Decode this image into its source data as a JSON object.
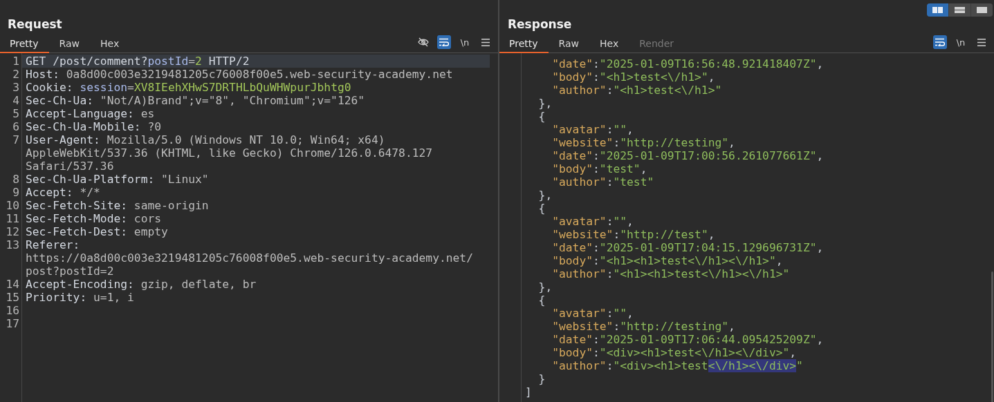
{
  "layout_buttons": [
    {
      "kind": "columns",
      "selected": true
    },
    {
      "kind": "rows",
      "selected": false
    },
    {
      "kind": "single",
      "selected": false
    }
  ],
  "request": {
    "title": "Request",
    "tabs": [
      {
        "label": "Pretty",
        "selected": true,
        "disabled": false
      },
      {
        "label": "Raw",
        "selected": false,
        "disabled": false
      },
      {
        "label": "Hex",
        "selected": false,
        "disabled": false
      }
    ],
    "toolbar": [
      {
        "kind": "hide",
        "on": false
      },
      {
        "kind": "wrap",
        "on": true
      },
      {
        "kind": "newline",
        "on": false,
        "label": "\\n"
      },
      {
        "kind": "menu",
        "on": false
      }
    ],
    "lines": [
      {
        "number": "1",
        "current": true,
        "rows": [
          [
            {
              "kind": "name",
              "text": "GET /post/comment?"
            },
            {
              "kind": "param",
              "text": "postId"
            },
            {
              "kind": "value",
              "text": "="
            },
            {
              "kind": "literal",
              "text": "2"
            },
            {
              "kind": "name",
              "text": " HTTP/2"
            }
          ]
        ]
      },
      {
        "number": "2",
        "current": false,
        "rows": [
          [
            {
              "kind": "name",
              "text": "Host:"
            },
            {
              "kind": "value",
              "text": " 0a8d00c003e3219481205c76008f00e5.web-security-academy.net"
            }
          ]
        ]
      },
      {
        "number": "3",
        "current": false,
        "rows": [
          [
            {
              "kind": "name",
              "text": "Cookie:"
            },
            {
              "kind": "value",
              "text": " "
            },
            {
              "kind": "param",
              "text": "session"
            },
            {
              "kind": "value",
              "text": "="
            },
            {
              "kind": "literal",
              "text": "XV8IEehXHwS7DRTHLbQuWHWpurJbhtg0"
            }
          ]
        ]
      },
      {
        "number": "4",
        "current": false,
        "rows": [
          [
            {
              "kind": "name",
              "text": "Sec-Ch-Ua:"
            },
            {
              "kind": "value",
              "text": " \"Not/A)Brand\";v=\"8\", \"Chromium\";v=\"126\""
            }
          ]
        ]
      },
      {
        "number": "5",
        "current": false,
        "rows": [
          [
            {
              "kind": "name",
              "text": "Accept-Language:"
            },
            {
              "kind": "value",
              "text": " es"
            }
          ]
        ]
      },
      {
        "number": "6",
        "current": false,
        "rows": [
          [
            {
              "kind": "name",
              "text": "Sec-Ch-Ua-Mobile:"
            },
            {
              "kind": "value",
              "text": " ?0"
            }
          ]
        ]
      },
      {
        "number": "7",
        "current": false,
        "rows": [
          [
            {
              "kind": "name",
              "text": "User-Agent:"
            },
            {
              "kind": "value",
              "text": " Mozilla/5.0 (Windows NT 10.0; Win64; x64)"
            }
          ],
          [
            {
              "kind": "value",
              "text": "AppleWebKit/537.36 (KHTML, like Gecko) Chrome/126.0.6478.127"
            }
          ],
          [
            {
              "kind": "value",
              "text": "Safari/537.36"
            }
          ]
        ]
      },
      {
        "number": "8",
        "current": false,
        "rows": [
          [
            {
              "kind": "name",
              "text": "Sec-Ch-Ua-Platform:"
            },
            {
              "kind": "value",
              "text": " \"Linux\""
            }
          ]
        ]
      },
      {
        "number": "9",
        "current": false,
        "rows": [
          [
            {
              "kind": "name",
              "text": "Accept:"
            },
            {
              "kind": "value",
              "text": " */*"
            }
          ]
        ]
      },
      {
        "number": "10",
        "current": false,
        "rows": [
          [
            {
              "kind": "name",
              "text": "Sec-Fetch-Site:"
            },
            {
              "kind": "value",
              "text": " same-origin"
            }
          ]
        ]
      },
      {
        "number": "11",
        "current": false,
        "rows": [
          [
            {
              "kind": "name",
              "text": "Sec-Fetch-Mode:"
            },
            {
              "kind": "value",
              "text": " cors"
            }
          ]
        ]
      },
      {
        "number": "12",
        "current": false,
        "rows": [
          [
            {
              "kind": "name",
              "text": "Sec-Fetch-Dest:"
            },
            {
              "kind": "value",
              "text": " empty"
            }
          ]
        ]
      },
      {
        "number": "13",
        "current": false,
        "rows": [
          [
            {
              "kind": "name",
              "text": "Referer:"
            }
          ],
          [
            {
              "kind": "value",
              "text": "https://0a8d00c003e3219481205c76008f00e5.web-security-academy.net/"
            }
          ],
          [
            {
              "kind": "value",
              "text": "post?postId=2"
            }
          ]
        ]
      },
      {
        "number": "14",
        "current": false,
        "rows": [
          [
            {
              "kind": "name",
              "text": "Accept-Encoding:"
            },
            {
              "kind": "value",
              "text": " gzip, deflate, br"
            }
          ]
        ]
      },
      {
        "number": "15",
        "current": false,
        "rows": [
          [
            {
              "kind": "name",
              "text": "Priority:"
            },
            {
              "kind": "value",
              "text": " u=1, i"
            }
          ]
        ]
      },
      {
        "number": "16",
        "current": false,
        "rows": [
          []
        ]
      },
      {
        "number": "17",
        "current": false,
        "rows": [
          []
        ]
      }
    ]
  },
  "response": {
    "title": "Response",
    "tabs": [
      {
        "label": "Pretty",
        "selected": true,
        "disabled": false
      },
      {
        "label": "Raw",
        "selected": false,
        "disabled": false
      },
      {
        "label": "Hex",
        "selected": false,
        "disabled": false
      },
      {
        "label": "Render",
        "selected": false,
        "disabled": true
      }
    ],
    "toolbar": [
      {
        "kind": "wrap",
        "on": true
      },
      {
        "kind": "newline",
        "on": false,
        "label": "\\n"
      },
      {
        "kind": "menu",
        "on": false
      }
    ],
    "lines": [
      {
        "kind": "field",
        "segments": [
          {
            "kind": "key",
            "text": "\"date\""
          },
          {
            "kind": "punct",
            "text": ":"
          },
          {
            "kind": "string",
            "text": "\"2025-01-09T16:56:48.921418407Z\""
          },
          {
            "kind": "punct",
            "text": ","
          }
        ]
      },
      {
        "kind": "field",
        "segments": [
          {
            "kind": "key",
            "text": "\"body\""
          },
          {
            "kind": "punct",
            "text": ":"
          },
          {
            "kind": "string",
            "text": "\"<h1>test<\\/h1>\""
          },
          {
            "kind": "punct",
            "text": ","
          }
        ]
      },
      {
        "kind": "field",
        "segments": [
          {
            "kind": "key",
            "text": "\"author\""
          },
          {
            "kind": "punct",
            "text": ":"
          },
          {
            "kind": "string",
            "text": "\"<h1>test<\\/h1>\""
          }
        ]
      },
      {
        "kind": "object",
        "segments": [
          {
            "kind": "punct",
            "text": "},"
          }
        ]
      },
      {
        "kind": "object",
        "segments": [
          {
            "kind": "punct",
            "text": "{"
          }
        ]
      },
      {
        "kind": "field",
        "segments": [
          {
            "kind": "key",
            "text": "\"avatar\""
          },
          {
            "kind": "punct",
            "text": ":"
          },
          {
            "kind": "string",
            "text": "\"\""
          },
          {
            "kind": "punct",
            "text": ","
          }
        ]
      },
      {
        "kind": "field",
        "segments": [
          {
            "kind": "key",
            "text": "\"website\""
          },
          {
            "kind": "punct",
            "text": ":"
          },
          {
            "kind": "string",
            "text": "\"http://testing\""
          },
          {
            "kind": "punct",
            "text": ","
          }
        ]
      },
      {
        "kind": "field",
        "segments": [
          {
            "kind": "key",
            "text": "\"date\""
          },
          {
            "kind": "punct",
            "text": ":"
          },
          {
            "kind": "string",
            "text": "\"2025-01-09T17:00:56.261077661Z\""
          },
          {
            "kind": "punct",
            "text": ","
          }
        ]
      },
      {
        "kind": "field",
        "segments": [
          {
            "kind": "key",
            "text": "\"body\""
          },
          {
            "kind": "punct",
            "text": ":"
          },
          {
            "kind": "string",
            "text": "\"test\""
          },
          {
            "kind": "punct",
            "text": ","
          }
        ]
      },
      {
        "kind": "field",
        "segments": [
          {
            "kind": "key",
            "text": "\"author\""
          },
          {
            "kind": "punct",
            "text": ":"
          },
          {
            "kind": "string",
            "text": "\"test\""
          }
        ]
      },
      {
        "kind": "object",
        "segments": [
          {
            "kind": "punct",
            "text": "},"
          }
        ]
      },
      {
        "kind": "object",
        "segments": [
          {
            "kind": "punct",
            "text": "{"
          }
        ]
      },
      {
        "kind": "field",
        "segments": [
          {
            "kind": "key",
            "text": "\"avatar\""
          },
          {
            "kind": "punct",
            "text": ":"
          },
          {
            "kind": "string",
            "text": "\"\""
          },
          {
            "kind": "punct",
            "text": ","
          }
        ]
      },
      {
        "kind": "field",
        "segments": [
          {
            "kind": "key",
            "text": "\"website\""
          },
          {
            "kind": "punct",
            "text": ":"
          },
          {
            "kind": "string",
            "text": "\"http://test\""
          },
          {
            "kind": "punct",
            "text": ","
          }
        ]
      },
      {
        "kind": "field",
        "segments": [
          {
            "kind": "key",
            "text": "\"date\""
          },
          {
            "kind": "punct",
            "text": ":"
          },
          {
            "kind": "string",
            "text": "\"2025-01-09T17:04:15.129696731Z\""
          },
          {
            "kind": "punct",
            "text": ","
          }
        ]
      },
      {
        "kind": "field",
        "segments": [
          {
            "kind": "key",
            "text": "\"body\""
          },
          {
            "kind": "punct",
            "text": ":"
          },
          {
            "kind": "string",
            "text": "\"<h1><h1>test<\\/h1><\\/h1>\""
          },
          {
            "kind": "punct",
            "text": ","
          }
        ]
      },
      {
        "kind": "field",
        "segments": [
          {
            "kind": "key",
            "text": "\"author\""
          },
          {
            "kind": "punct",
            "text": ":"
          },
          {
            "kind": "string",
            "text": "\"<h1><h1>test<\\/h1><\\/h1>\""
          }
        ]
      },
      {
        "kind": "object",
        "segments": [
          {
            "kind": "punct",
            "text": "},"
          }
        ]
      },
      {
        "kind": "object",
        "segments": [
          {
            "kind": "punct",
            "text": "{"
          }
        ]
      },
      {
        "kind": "field",
        "segments": [
          {
            "kind": "key",
            "text": "\"avatar\""
          },
          {
            "kind": "punct",
            "text": ":"
          },
          {
            "kind": "string",
            "text": "\"\""
          },
          {
            "kind": "punct",
            "text": ","
          }
        ]
      },
      {
        "kind": "field",
        "segments": [
          {
            "kind": "key",
            "text": "\"website\""
          },
          {
            "kind": "punct",
            "text": ":"
          },
          {
            "kind": "string",
            "text": "\"http://testing\""
          },
          {
            "kind": "punct",
            "text": ","
          }
        ]
      },
      {
        "kind": "field",
        "segments": [
          {
            "kind": "key",
            "text": "\"date\""
          },
          {
            "kind": "punct",
            "text": ":"
          },
          {
            "kind": "string",
            "text": "\"2025-01-09T17:06:44.095425209Z\""
          },
          {
            "kind": "punct",
            "text": ","
          }
        ]
      },
      {
        "kind": "field",
        "segments": [
          {
            "kind": "key",
            "text": "\"body\""
          },
          {
            "kind": "punct",
            "text": ":"
          },
          {
            "kind": "string",
            "text": "\"<div><h1>test<\\/h1><\\/div>\""
          },
          {
            "kind": "punct",
            "text": ","
          }
        ]
      },
      {
        "kind": "field",
        "segments": [
          {
            "kind": "key",
            "text": "\"author\""
          },
          {
            "kind": "punct",
            "text": ":"
          },
          {
            "kind": "string",
            "text": "\"<div><h1>test"
          },
          {
            "kind": "selection",
            "text": "<\\/h1><\\/div>"
          },
          {
            "kind": "string",
            "text": "\""
          }
        ]
      },
      {
        "kind": "object",
        "segments": [
          {
            "kind": "punct",
            "text": "}"
          }
        ]
      },
      {
        "kind": "root",
        "segments": [
          {
            "kind": "punct",
            "text": "]"
          }
        ]
      }
    ]
  }
}
